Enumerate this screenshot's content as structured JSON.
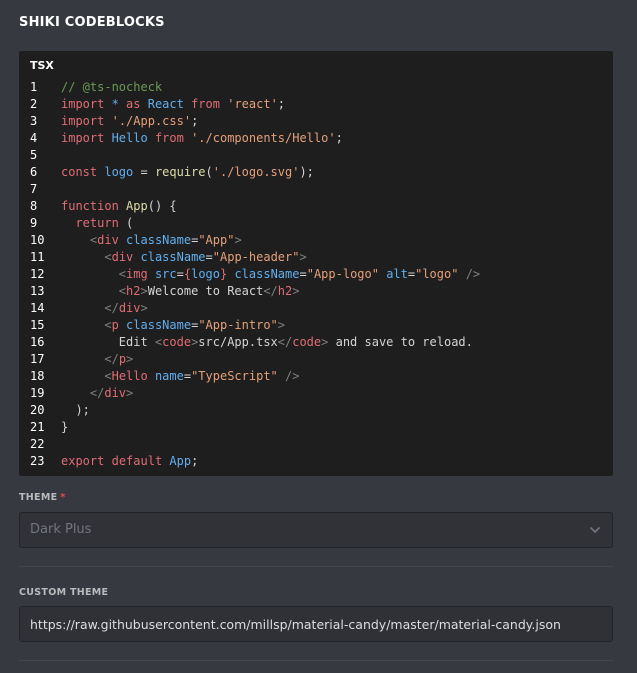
{
  "page": {
    "title": "SHIKI CODEBLOCKS"
  },
  "code_block": {
    "language": "TSX",
    "lines": [
      {
        "n": "1",
        "tokens": [
          {
            "t": "// @ts-nocheck",
            "c": "comment"
          }
        ]
      },
      {
        "n": "2",
        "tokens": [
          {
            "t": "import",
            "c": "keyword"
          },
          {
            "t": " * ",
            "c": "ident"
          },
          {
            "t": "as",
            "c": "keyword"
          },
          {
            "t": " React ",
            "c": "ident"
          },
          {
            "t": "from",
            "c": "keyword"
          },
          {
            "t": " ",
            "c": "plain"
          },
          {
            "t": "'react'",
            "c": "string"
          },
          {
            "t": ";",
            "c": "plain"
          }
        ]
      },
      {
        "n": "3",
        "tokens": [
          {
            "t": "import",
            "c": "keyword"
          },
          {
            "t": " ",
            "c": "plain"
          },
          {
            "t": "'./App.css'",
            "c": "string"
          },
          {
            "t": ";",
            "c": "plain"
          }
        ]
      },
      {
        "n": "4",
        "tokens": [
          {
            "t": "import",
            "c": "keyword"
          },
          {
            "t": " Hello ",
            "c": "ident"
          },
          {
            "t": "from",
            "c": "keyword"
          },
          {
            "t": " ",
            "c": "plain"
          },
          {
            "t": "'./components/Hello'",
            "c": "string"
          },
          {
            "t": ";",
            "c": "plain"
          }
        ]
      },
      {
        "n": "5",
        "tokens": []
      },
      {
        "n": "6",
        "tokens": [
          {
            "t": "const",
            "c": "keyword"
          },
          {
            "t": " logo ",
            "c": "ident"
          },
          {
            "t": "= ",
            "c": "plain"
          },
          {
            "t": "require",
            "c": "func"
          },
          {
            "t": "(",
            "c": "plain"
          },
          {
            "t": "'./logo.svg'",
            "c": "string"
          },
          {
            "t": ");",
            "c": "plain"
          }
        ]
      },
      {
        "n": "7",
        "tokens": []
      },
      {
        "n": "8",
        "tokens": [
          {
            "t": "function",
            "c": "keyword"
          },
          {
            "t": " ",
            "c": "plain"
          },
          {
            "t": "App",
            "c": "func"
          },
          {
            "t": "() {",
            "c": "plain"
          }
        ]
      },
      {
        "n": "9",
        "tokens": [
          {
            "t": "  ",
            "c": "plain"
          },
          {
            "t": "return",
            "c": "keyword"
          },
          {
            "t": " (",
            "c": "plain"
          }
        ]
      },
      {
        "n": "10",
        "tokens": [
          {
            "t": "    ",
            "c": "plain"
          },
          {
            "t": "<",
            "c": "tag"
          },
          {
            "t": "div",
            "c": "tagname"
          },
          {
            "t": " className",
            "c": "attr"
          },
          {
            "t": "=",
            "c": "plain"
          },
          {
            "t": "\"App\"",
            "c": "string"
          },
          {
            "t": ">",
            "c": "tag"
          }
        ]
      },
      {
        "n": "11",
        "tokens": [
          {
            "t": "      ",
            "c": "plain"
          },
          {
            "t": "<",
            "c": "tag"
          },
          {
            "t": "div",
            "c": "tagname"
          },
          {
            "t": " className",
            "c": "attr"
          },
          {
            "t": "=",
            "c": "plain"
          },
          {
            "t": "\"App-header\"",
            "c": "string"
          },
          {
            "t": ">",
            "c": "tag"
          }
        ]
      },
      {
        "n": "12",
        "tokens": [
          {
            "t": "        ",
            "c": "plain"
          },
          {
            "t": "<",
            "c": "tag"
          },
          {
            "t": "img",
            "c": "tagname"
          },
          {
            "t": " src",
            "c": "attr"
          },
          {
            "t": "=",
            "c": "plain"
          },
          {
            "t": "{",
            "c": "keyword"
          },
          {
            "t": "logo",
            "c": "ident"
          },
          {
            "t": "}",
            "c": "keyword"
          },
          {
            "t": " className",
            "c": "attr"
          },
          {
            "t": "=",
            "c": "plain"
          },
          {
            "t": "\"App-logo\"",
            "c": "string"
          },
          {
            "t": " alt",
            "c": "attr"
          },
          {
            "t": "=",
            "c": "plain"
          },
          {
            "t": "\"logo\"",
            "c": "string"
          },
          {
            "t": " />",
            "c": "tag"
          }
        ]
      },
      {
        "n": "13",
        "tokens": [
          {
            "t": "        ",
            "c": "plain"
          },
          {
            "t": "<",
            "c": "tag"
          },
          {
            "t": "h2",
            "c": "tagname"
          },
          {
            "t": ">",
            "c": "tag"
          },
          {
            "t": "Welcome to React",
            "c": "plain"
          },
          {
            "t": "</",
            "c": "tag"
          },
          {
            "t": "h2",
            "c": "tagname"
          },
          {
            "t": ">",
            "c": "tag"
          }
        ]
      },
      {
        "n": "14",
        "tokens": [
          {
            "t": "      ",
            "c": "plain"
          },
          {
            "t": "</",
            "c": "tag"
          },
          {
            "t": "div",
            "c": "tagname"
          },
          {
            "t": ">",
            "c": "tag"
          }
        ]
      },
      {
        "n": "15",
        "tokens": [
          {
            "t": "      ",
            "c": "plain"
          },
          {
            "t": "<",
            "c": "tag"
          },
          {
            "t": "p",
            "c": "tagname"
          },
          {
            "t": " className",
            "c": "attr"
          },
          {
            "t": "=",
            "c": "plain"
          },
          {
            "t": "\"App-intro\"",
            "c": "string"
          },
          {
            "t": ">",
            "c": "tag"
          }
        ]
      },
      {
        "n": "16",
        "tokens": [
          {
            "t": "        Edit ",
            "c": "plain"
          },
          {
            "t": "<",
            "c": "tag"
          },
          {
            "t": "code",
            "c": "tagname"
          },
          {
            "t": ">",
            "c": "tag"
          },
          {
            "t": "src/App.tsx",
            "c": "plain"
          },
          {
            "t": "</",
            "c": "tag"
          },
          {
            "t": "code",
            "c": "tagname"
          },
          {
            "t": ">",
            "c": "tag"
          },
          {
            "t": " and save to reload.",
            "c": "plain"
          }
        ]
      },
      {
        "n": "17",
        "tokens": [
          {
            "t": "      ",
            "c": "plain"
          },
          {
            "t": "</",
            "c": "tag"
          },
          {
            "t": "p",
            "c": "tagname"
          },
          {
            "t": ">",
            "c": "tag"
          }
        ]
      },
      {
        "n": "18",
        "tokens": [
          {
            "t": "      ",
            "c": "plain"
          },
          {
            "t": "<",
            "c": "tag"
          },
          {
            "t": "Hello",
            "c": "tagname"
          },
          {
            "t": " name",
            "c": "attr"
          },
          {
            "t": "=",
            "c": "plain"
          },
          {
            "t": "\"TypeScript\"",
            "c": "string"
          },
          {
            "t": " />",
            "c": "tag"
          }
        ]
      },
      {
        "n": "19",
        "tokens": [
          {
            "t": "    ",
            "c": "plain"
          },
          {
            "t": "</",
            "c": "tag"
          },
          {
            "t": "div",
            "c": "tagname"
          },
          {
            "t": ">",
            "c": "tag"
          }
        ]
      },
      {
        "n": "20",
        "tokens": [
          {
            "t": "  );",
            "c": "plain"
          }
        ]
      },
      {
        "n": "21",
        "tokens": [
          {
            "t": "}",
            "c": "plain"
          }
        ]
      },
      {
        "n": "22",
        "tokens": []
      },
      {
        "n": "23",
        "tokens": [
          {
            "t": "export",
            "c": "keyword"
          },
          {
            "t": " ",
            "c": "plain"
          },
          {
            "t": "default",
            "c": "keyword"
          },
          {
            "t": " App",
            "c": "ident"
          },
          {
            "t": ";",
            "c": "plain"
          }
        ]
      }
    ]
  },
  "theme_field": {
    "label": "THEME",
    "required_mark": "*",
    "value": "Dark Plus",
    "icon": "chevron-down-icon"
  },
  "custom_theme_field": {
    "label": "CUSTOM THEME",
    "value": "https://raw.githubusercontent.com/millsp/material-candy/master/material-candy.json"
  },
  "colors": {
    "background": "#36393f",
    "code_background": "#1e1e1e",
    "required": "#f04747"
  }
}
